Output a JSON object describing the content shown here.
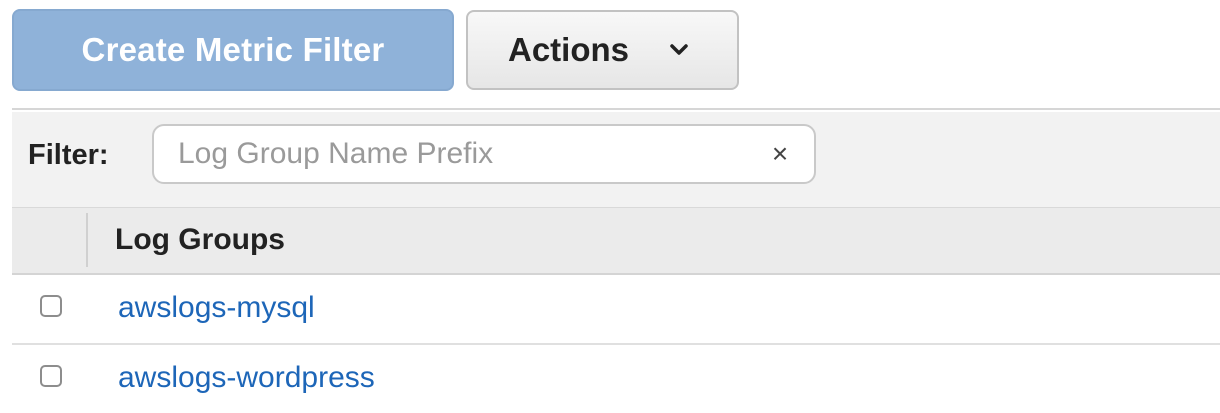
{
  "toolbar": {
    "create_label": "Create Metric Filter",
    "actions_label": "Actions",
    "actions_icon": "chevron-down-icon"
  },
  "filter": {
    "label": "Filter:",
    "placeholder": "Log Group Name Prefix",
    "value": "",
    "clear_glyph": "×"
  },
  "table": {
    "header": "Log Groups",
    "rows": [
      {
        "name": "awslogs-mysql",
        "checked": false
      },
      {
        "name": "awslogs-wordpress",
        "checked": false
      }
    ]
  },
  "colors": {
    "primary_button": "#8fb2d9",
    "link": "#1d66b8",
    "header_bg": "#ebebeb"
  }
}
